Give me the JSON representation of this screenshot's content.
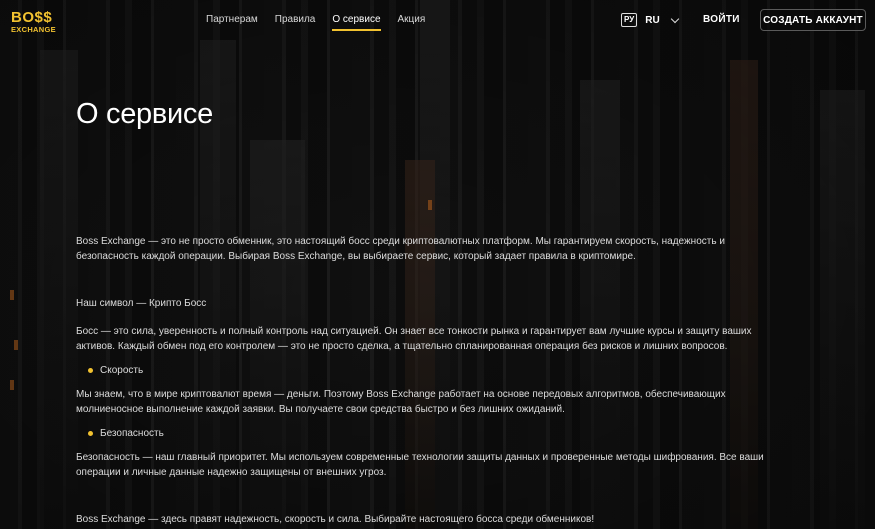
{
  "header": {
    "logo_main": "BO$$",
    "logo_sub": "EXCHANGE",
    "nav": [
      {
        "label": "Партнерам",
        "active": false
      },
      {
        "label": "Правила",
        "active": false
      },
      {
        "label": "О сервисе",
        "active": true
      },
      {
        "label": "Акция",
        "active": false
      }
    ],
    "lang_flag": "РУ",
    "lang_code": "RU",
    "login_label": "ВОЙТИ",
    "signup_label": "СОЗДАТЬ АККАУНТ"
  },
  "page": {
    "title": "О сервисе",
    "intro": "Boss Exchange — это не просто обменник, это настоящий босс среди криптовалютных платформ. Мы гарантируем скорость, надежность и безопасность каждой операции. Выбирая Boss Exchange, вы выбираете сервис, который задает правила в криптомире.",
    "symbol_heading": "Наш символ — Крипто Босс",
    "boss_text": "Босс — это сила, уверенность и полный контроль над ситуацией. Он знает все тонкости рынка и гарантирует вам лучшие курсы и защиту ваших активов. Каждый обмен под его контролем — это не просто сделка, а тщательно спланированная операция без рисков и лишних вопросов.",
    "bullet_speed": "Скорость",
    "speed_text": "Мы знаем, что в мире криптовалют время — деньги. Поэтому Boss Exchange работает на основе передовых алгоритмов, обеспечивающих молниеносное выполнение каждой заявки. Вы получаете свои средства быстро и без лишних ожиданий.",
    "bullet_security": "Безопасность",
    "security_text": "Безопасность — наш главный приоритет. Мы используем современные технологии защиты данных и проверенные методы шифрования. Все ваши операции и личные данные надежно защищены от внешних угроз.",
    "closing": "Boss Exchange — здесь правят надежность, скорость и сила. Выбирайте настоящего босса среди обменников!"
  },
  "colors": {
    "accent": "#f2c230",
    "background": "#121212",
    "text": "#dcdcdc"
  },
  "icons": {
    "lang_chevron": "chevron-down-icon",
    "bullet": "bullet-dot-icon"
  }
}
